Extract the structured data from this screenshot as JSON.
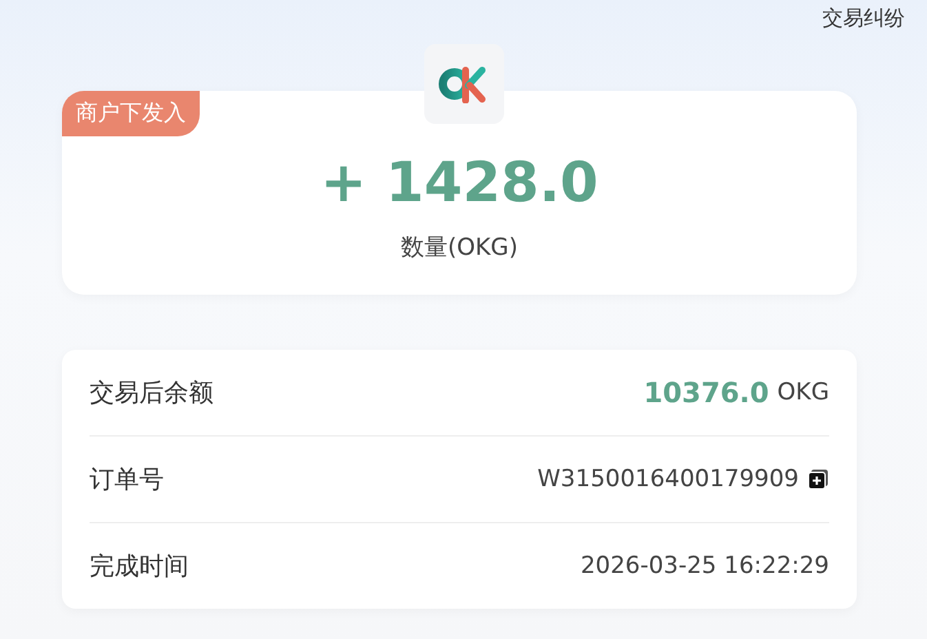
{
  "header": {
    "link": "交易纠纷"
  },
  "summary": {
    "tag": "商户下发入",
    "amount": "+ 1428.0",
    "caption": "数量(OKG)"
  },
  "details": [
    {
      "kind": "amount",
      "label": "交易后余额",
      "value": "10376.0",
      "unit": "OKG"
    },
    {
      "kind": "copy",
      "label": "订单号",
      "value": "W3150016400179909"
    },
    {
      "kind": "text",
      "label": "完成时间",
      "value": "2026-03-25 16:22:29"
    }
  ]
}
